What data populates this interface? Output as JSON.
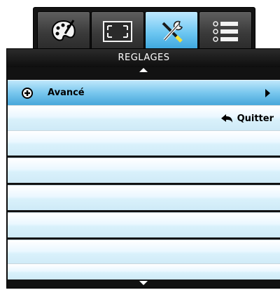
{
  "tabs": [
    {
      "icon": "image-palette-icon",
      "active": false
    },
    {
      "icon": "screen-resize-icon",
      "active": false
    },
    {
      "icon": "settings-tools-icon",
      "active": true
    },
    {
      "icon": "options-list-icon",
      "active": false
    }
  ],
  "panel": {
    "title": "REGLAGES",
    "rows": [
      {
        "label": "Avancé",
        "icon": "plus-circle-icon",
        "submenu": true
      },
      {
        "label": "Quitter",
        "icon": "back-arrow-icon"
      }
    ]
  },
  "colors": {
    "highlight": "#5bb7e6",
    "row": "#e6f6ff",
    "panel": "#121212"
  }
}
